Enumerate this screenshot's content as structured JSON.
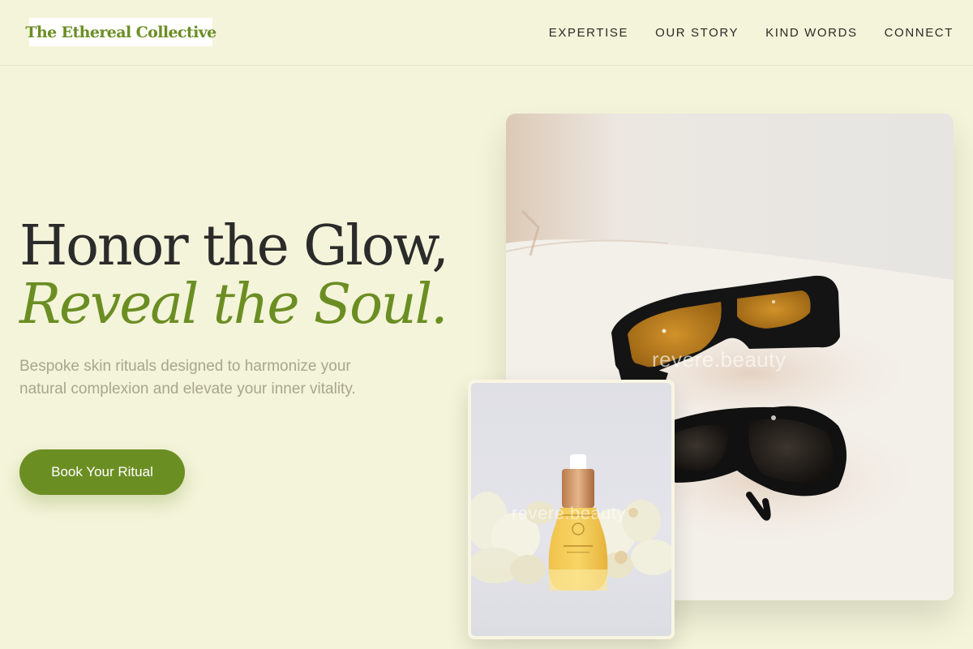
{
  "brand": {
    "name": "The Ethereal Collective"
  },
  "nav": {
    "items": [
      {
        "label": "EXPERTISE"
      },
      {
        "label": "OUR STORY"
      },
      {
        "label": "KIND WORDS"
      },
      {
        "label": "CONNECT"
      }
    ]
  },
  "hero": {
    "title_line1": "Honor the Glow,",
    "title_line2": "Reveal the Soul.",
    "subtitle": "Bespoke skin rituals designed to harmonize your natural complexion and elevate your inner vitality.",
    "cta_label": "Book Your Ritual"
  },
  "images": {
    "main_watermark": "revere.beauty",
    "product_watermark": "revere.beauty"
  },
  "colors": {
    "background": "#f4f4da",
    "accent": "#6b8e23",
    "text": "#2b2b2b",
    "muted_text": "#a8a68c"
  }
}
